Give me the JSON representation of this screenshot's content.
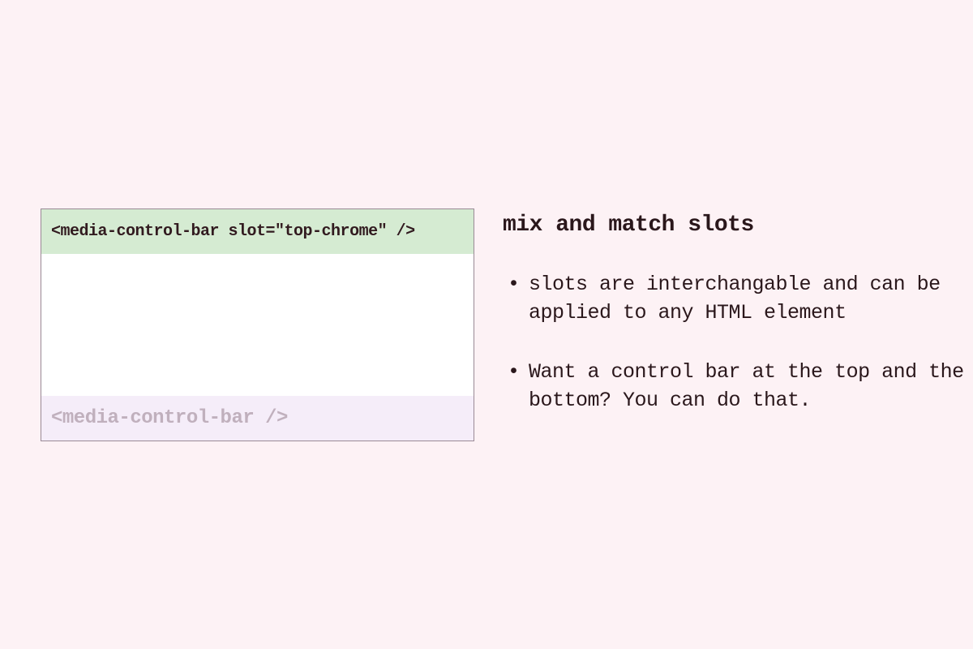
{
  "diagram": {
    "top_label": "<media-control-bar slot=\"top-chrome\" />",
    "bottom_label": "<media-control-bar />"
  },
  "content": {
    "heading": "mix and match slots",
    "bullets": [
      "slots are interchangable and can be applied to any HTML element",
      "Want a control bar at the top and the bottom? You can do that."
    ]
  }
}
